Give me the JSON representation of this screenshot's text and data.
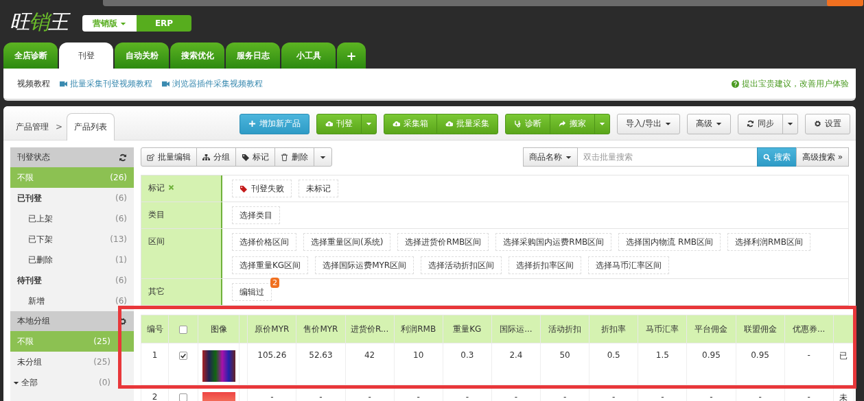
{
  "logo": {
    "text": "旺销王"
  },
  "edition_buttons": [
    {
      "label": "营销版",
      "kind": "dropdown",
      "selected": true
    },
    {
      "label": "ERP",
      "kind": "text",
      "selected": false
    }
  ],
  "main_tabs": [
    {
      "label": "全店诊断",
      "selected": false
    },
    {
      "label": "刊登",
      "selected": true
    },
    {
      "label": "自动关粉",
      "selected": false
    },
    {
      "label": "搜索优化",
      "selected": false
    },
    {
      "label": "服务日志",
      "selected": false
    },
    {
      "label": "小工具",
      "selected": false
    },
    {
      "label": "+",
      "selected": false
    }
  ],
  "video_bar": {
    "label": "视频教程",
    "links": [
      "批量采集刊登视频教程",
      "浏览器插件采集视频教程"
    ],
    "feedback": "提出宝贵建议，改善用户体验"
  },
  "breadcrumb": {
    "separator": ">",
    "items": [
      {
        "label": "产品管理",
        "selected": false
      },
      {
        "label": "产品列表",
        "selected": true
      }
    ]
  },
  "toolbar": [
    [
      {
        "kind": "text",
        "label": "增加新产品"
      }
    ],
    [
      {
        "kind": "text",
        "label": "刊登"
      },
      {
        "kind": "caret"
      }
    ],
    [
      {
        "kind": "text",
        "label": "采集箱"
      },
      {
        "kind": "text",
        "label": "批量采集"
      }
    ],
    [
      {
        "kind": "text",
        "label": "诊断"
      },
      {
        "kind": "text",
        "label": "搬家"
      },
      {
        "kind": "caret"
      }
    ],
    [
      {
        "kind": "dropdown",
        "label": "导入/导出"
      }
    ],
    [
      {
        "kind": "dropdown",
        "label": "高级"
      }
    ],
    [
      {
        "kind": "text",
        "label": "同步"
      },
      {
        "kind": "caret"
      }
    ],
    [
      {
        "kind": "text",
        "label": "设置"
      }
    ]
  ],
  "sidebar": [
    {
      "title": "刊登状态",
      "items": [
        {
          "label": "不限",
          "count": "(26)",
          "selected": true
        },
        {
          "label": "已刊登",
          "count": "(6)",
          "selected": false,
          "children": [
            {
              "label": "已上架",
              "count": "(6)",
              "selected": false
            },
            {
              "label": "已下架",
              "count": "(13)",
              "selected": false
            },
            {
              "label": "已删除",
              "count": "(1)",
              "selected": false
            }
          ]
        },
        {
          "label": "待刊登",
          "count": "(6)",
          "selected": false,
          "children": [
            {
              "label": "新增",
              "count": "(6)",
              "selected": false
            }
          ]
        }
      ]
    },
    {
      "title": "本地分组",
      "items": [
        {
          "label": "不限",
          "count": "(25)",
          "selected": true
        },
        {
          "label": "未分组",
          "count": "(25)",
          "selected": false
        },
        {
          "label": "全部",
          "count": "(0)",
          "selected": false,
          "expanded": true
        }
      ]
    }
  ],
  "actions": [
    {
      "kind": "text",
      "label": "批量编辑"
    },
    {
      "kind": "text",
      "label": "分组"
    },
    {
      "kind": "text",
      "label": "标记"
    },
    {
      "kind": "text",
      "label": "删除"
    },
    {
      "kind": "caret"
    }
  ],
  "search": {
    "field_select": "商品名称",
    "placeholder": "双击批量搜索",
    "button": "搜索",
    "advanced": "高级搜索 »"
  },
  "filters": [
    {
      "label": "标记",
      "clearable": true,
      "options": [
        {
          "label": "刊登失败"
        },
        {
          "label": "未标记"
        }
      ]
    },
    {
      "label": "类目",
      "clearable": false,
      "options": [
        {
          "label": "选择类目"
        }
      ]
    },
    {
      "label": "区间",
      "clearable": false,
      "options": [
        {
          "label": "选择价格区间"
        },
        {
          "label": "选择重量区间(系统)"
        },
        {
          "label": "选择进货价RMB区间"
        },
        {
          "label": "选择采购国内运费RMB区间"
        },
        {
          "label": "选择国内物流 RMB区间"
        },
        {
          "label": "选择利润RMB区间"
        },
        {
          "label": "选择重量KG区间"
        },
        {
          "label": "选择国际运费MYR区间"
        },
        {
          "label": "选择活动折扣区间"
        },
        {
          "label": "选择折扣率区间"
        },
        {
          "label": "选择马币汇率区间"
        }
      ]
    },
    {
      "label": "其它",
      "clearable": false,
      "options": [
        {
          "label": "编辑过",
          "badge": "2"
        }
      ]
    }
  ],
  "table": {
    "all_checked": false,
    "columns": [
      {
        "label": "编号",
        "kind": "text"
      },
      {
        "kind": "check"
      },
      {
        "label": "图像",
        "kind": "image"
      },
      {
        "kind": "spacer"
      },
      {
        "label": "原价MYR",
        "kind": "text"
      },
      {
        "label": "售价MYR",
        "kind": "text"
      },
      {
        "label": "进货价R...",
        "kind": "text"
      },
      {
        "label": "利润RMB",
        "kind": "text"
      },
      {
        "label": "重量KG",
        "kind": "text"
      },
      {
        "label": "国际运...",
        "kind": "text"
      },
      {
        "label": "活动折扣",
        "kind": "text"
      },
      {
        "label": "折扣率",
        "kind": "text"
      },
      {
        "label": "马币汇率",
        "kind": "text"
      },
      {
        "label": "平台佣金",
        "kind": "text"
      },
      {
        "label": "联盟佣金",
        "kind": "text"
      },
      {
        "label": "优惠券...",
        "kind": "text"
      },
      {
        "kind": "text"
      }
    ],
    "rows": [
      {
        "checked": true,
        "cells": [
          "1",
          "",
          "",
          "",
          "105.26",
          "52.63",
          "42",
          "10",
          "0.3",
          "2.4",
          "50",
          "0.5",
          "1.5",
          "0.95",
          "0.95",
          "-",
          "已"
        ]
      },
      {
        "checked": false,
        "cells": [
          "2",
          "",
          "",
          "",
          "-",
          "-",
          "-",
          "-",
          "-",
          "-",
          "-",
          "-",
          "-",
          "-",
          "-",
          "-",
          "未"
        ]
      }
    ]
  }
}
